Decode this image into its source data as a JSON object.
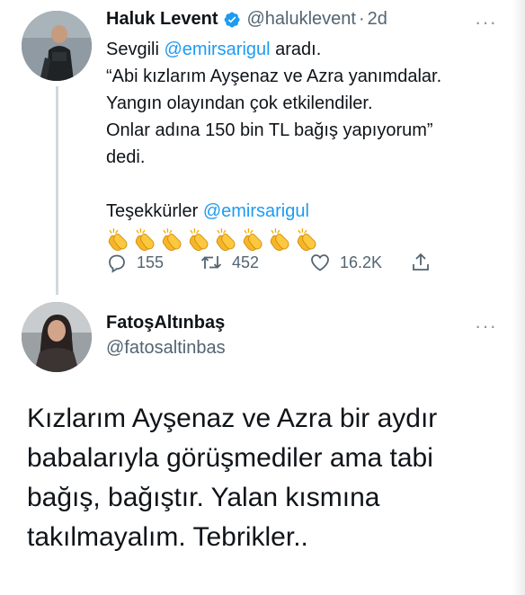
{
  "tweet1": {
    "author_name": "Haluk Levent",
    "handle": "@haluklevent",
    "separator": "·",
    "time": "2d",
    "more": "···",
    "text_line1_prefix": "Sevgili ",
    "text_line1_mention": "@emirsarigul",
    "text_line1_suffix": " aradı.",
    "text_line2": "“Abi kızlarım Ayşenaz ve Azra yanımdalar.",
    "text_line3": "Yangın olayından çok etkilendiler.",
    "text_line4": "Onlar adına 150 bin TL bağış yapıyorum”",
    "text_line5": "dedi.",
    "thanks_prefix": "Teşekkürler ",
    "thanks_mention": "@emirsarigul",
    "clap_count": 8,
    "replies": "155",
    "retweets": "452",
    "likes": "16.2K",
    "colors": {
      "mention": "#1d9bf0",
      "verified": "#1d9bf0",
      "muted": "#536471"
    }
  },
  "tweet2": {
    "author_name": "FatoşAltınbaş",
    "handle": "@fatosaltinbas",
    "more": "···",
    "text_line1": "Kızlarım Ayşenaz ve Azra bir aydır",
    "text_line2": "babalarıyla görüşmediler ama tabi",
    "text_line3": "bağış, bağıştır. Yalan kısmına",
    "text_line4": "takılmayalım. Tebrikler.."
  },
  "icons": [
    "verified-badge-icon",
    "more-icon",
    "clapping-hands-icon",
    "reply-icon",
    "retweet-icon",
    "like-icon",
    "share-icon"
  ]
}
